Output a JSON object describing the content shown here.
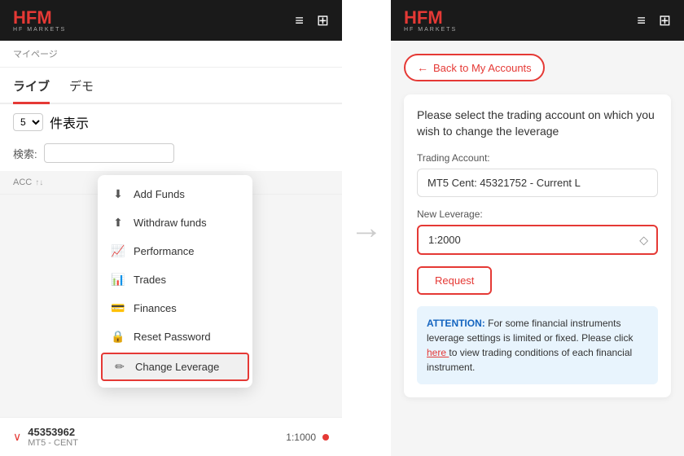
{
  "app": {
    "name": "HF",
    "name_accent": "M",
    "subtitle": "HF MARKETS",
    "header_icons": [
      "≡",
      "⊞"
    ]
  },
  "left": {
    "breadcrumb": "マイページ",
    "tabs": [
      {
        "label": "ライブ",
        "active": true
      },
      {
        "label": "デモ",
        "active": false
      }
    ],
    "show_count": "5",
    "show_label": "件表示",
    "search_label": "検索:",
    "search_placeholder": "",
    "table_headers": {
      "acc": "ACC",
      "sort_icon": "↑↓"
    },
    "menu": {
      "items": [
        {
          "icon": "⬇",
          "label": "Add Funds"
        },
        {
          "icon": "⬆",
          "label": "Withdraw funds"
        },
        {
          "icon": "📈",
          "label": "Performance"
        },
        {
          "icon": "📊",
          "label": "Trades"
        },
        {
          "icon": "💳",
          "label": "Finances"
        },
        {
          "icon": "🔒",
          "label": "Reset Password"
        },
        {
          "icon": "✏",
          "label": "Change Leverage",
          "highlighted": true
        }
      ]
    },
    "account_bottom": {
      "expand_icon": "∨",
      "number": "45353962",
      "type": "MT5 - CENT",
      "leverage": "1:1000"
    }
  },
  "right": {
    "back_button": "Back to My Accounts",
    "back_arrow": "←",
    "form": {
      "title": "Please select the trading account on which you wish to change the leverage",
      "trading_account_label": "Trading Account:",
      "trading_account_value": "MT5 Cent: 45321752 - Current L",
      "new_leverage_label": "New Leverage:",
      "leverage_value": "1:2000",
      "request_button": "Request",
      "attention": {
        "label": "ATTENTION:",
        "text": " For some financial instruments leverage settings is limited or fixed. Please click ",
        "link": "here",
        "text2": " to view trading conditions of each financial instrument."
      }
    }
  }
}
